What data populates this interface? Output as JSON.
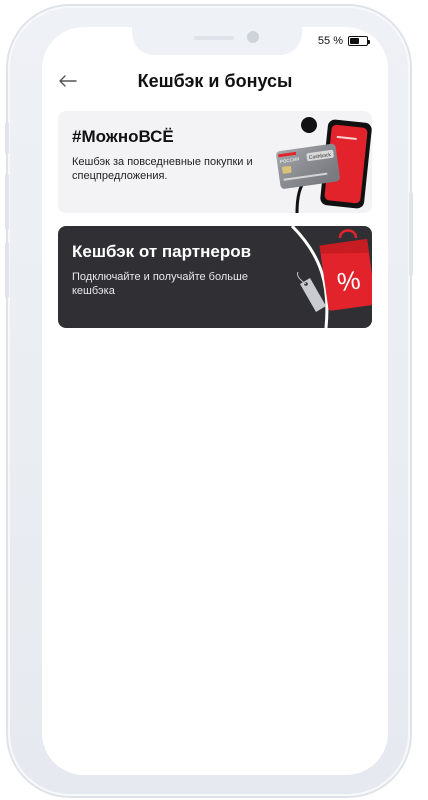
{
  "status_bar": {
    "battery_text": "55 %",
    "battery_level": 0.55
  },
  "header": {
    "back_icon": "arrow-left-icon",
    "title": "Кешбэк и бонусы"
  },
  "cards": [
    {
      "title": "#МожноВСЁ",
      "subtitle": "Кешбэк за повседневные покупки и спецпредложения.",
      "card_brand": "РОССИЯ",
      "card_badge": "Cashback"
    },
    {
      "title": "Кешбэк от партнеров",
      "subtitle": "Подключайте и получайте больше кешбэка",
      "percent": "%"
    }
  ],
  "colors": {
    "accent_red": "#e3232b",
    "dark_card": "#303034",
    "light_card": "#f3f3f5"
  }
}
